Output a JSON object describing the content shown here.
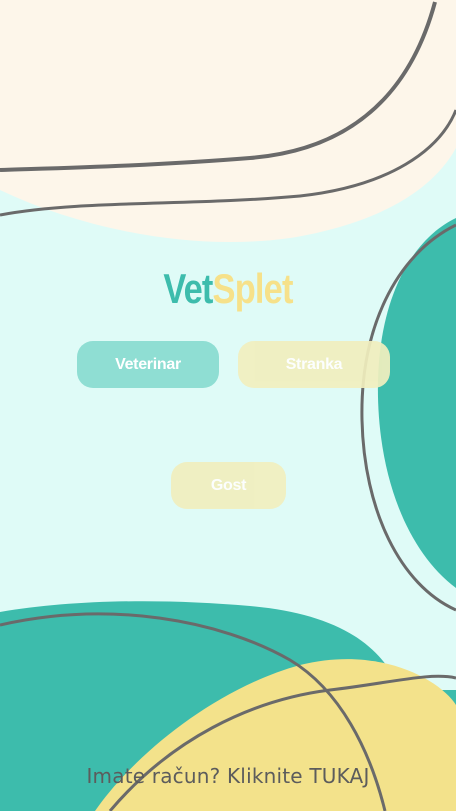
{
  "logo": {
    "part1": "Vet",
    "part2": "Splet"
  },
  "buttons": {
    "veterinar": "Veterinar",
    "stranka": "Stranka",
    "gost": "Gost"
  },
  "footer": {
    "login_link": "Imate račun? Kliknite TUKAJ"
  },
  "colors": {
    "background": "#dffbf7",
    "cream": "#fdf6ea",
    "teal": "#3dbcac",
    "yellow": "#f3e28b",
    "line": "#6a6a6a"
  }
}
